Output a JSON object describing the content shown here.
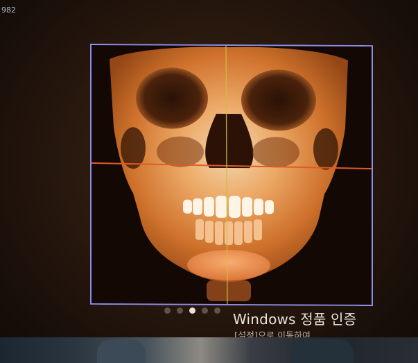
{
  "screen": {
    "corner_text": "982"
  },
  "viewer": {
    "image_description": "3D CT volume rendering of skull, frontal view",
    "frame_color": "#8c8ee8",
    "crosshair_color": "#e05a28"
  },
  "lock_screen": {
    "slide_count": 5,
    "active_slide": 3,
    "activation_title": "Windows 정품 인증",
    "activation_subtitle": "[설정]으로 이동하여"
  }
}
